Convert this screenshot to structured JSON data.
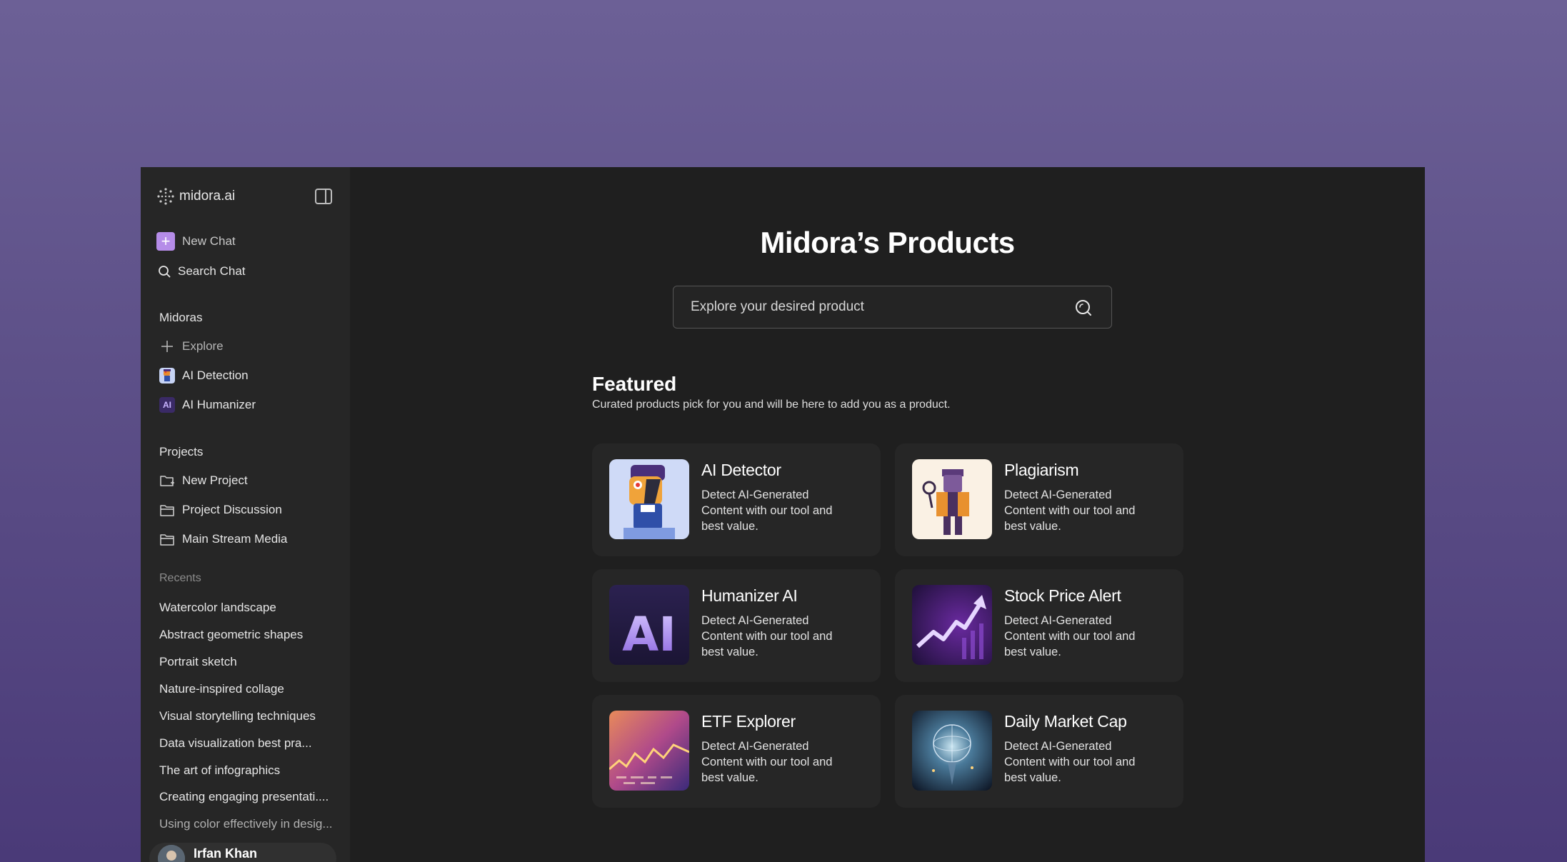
{
  "sidebar": {
    "brand": "midora.ai",
    "new_chat": "New Chat",
    "search_chat": "Search Chat",
    "midoras": {
      "title": "Midoras",
      "items": [
        "Explore",
        "AI Detection",
        "AI Humanizer"
      ],
      "badge": "AI"
    },
    "projects": {
      "title": "Projects",
      "items": [
        "New Project",
        "Project Discussion",
        "Main Stream Media"
      ]
    },
    "recents": {
      "title": "Recents",
      "items": [
        "Watercolor landscape",
        "Abstract geometric shapes",
        "Portrait sketch",
        "Nature-inspired collage",
        "Visual storytelling techniques",
        "Data visualization best pra...",
        "The art of infographics",
        "Creating engaging presentati....",
        "Using color effectively in desig..."
      ]
    },
    "user": {
      "name": "Irfan Khan"
    }
  },
  "main": {
    "title": "Midora’s Products",
    "search_placeholder": "Explore your desired product",
    "featured": {
      "title": "Featured",
      "subtitle": "Curated products pick for you and will be here to add you as a product."
    },
    "products": [
      {
        "title": "AI Detector",
        "desc": "Detect AI-Generated Content with our tool and best value."
      },
      {
        "title": "Plagiarism",
        "desc": "Detect AI-Generated Content with our tool and best value."
      },
      {
        "title": "Humanizer AI",
        "desc": "Detect AI-Generated Content with our tool and best value.",
        "thumb_text": "AI"
      },
      {
        "title": "Stock Price Alert",
        "desc": "Detect AI-Generated Content with our tool and best value."
      },
      {
        "title": "ETF Explorer",
        "desc": "Detect AI-Generated Content with our tool and best value."
      },
      {
        "title": "Daily Market Cap",
        "desc": "Detect AI-Generated Content with our tool and best value."
      }
    ]
  },
  "colors": {
    "background_top": "#6c6096",
    "window": "#1f1f1f",
    "sidebar": "#262626",
    "card": "#262626",
    "accent": "#b58ce8"
  }
}
